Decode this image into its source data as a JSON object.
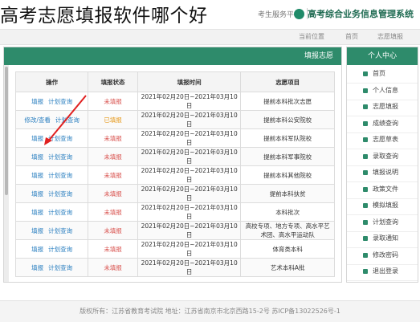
{
  "headline": "高考志愿填报软件哪个好",
  "topbar": {
    "brand": "高考综合业务信息管理系统",
    "sub": "考生服务平台"
  },
  "crumb": {
    "a": "当前位置",
    "b": "首页",
    "c": "志愿填报"
  },
  "main": {
    "header": "填报志愿",
    "columns": [
      "志愿项目",
      "填报时间",
      "填报状态",
      "操作"
    ],
    "rows": [
      {
        "item": "提前本科批次志愿",
        "time": "2021年02月20日~2021年03月10日",
        "status": "未填报",
        "actions": [
          "填报",
          "计划查询"
        ]
      },
      {
        "item": "提前本科公安院校",
        "time": "2021年02月20日~2021年03月10日",
        "status": "已填报",
        "actions": [
          "修改/查看",
          "计划查询"
        ]
      },
      {
        "item": "提前本科军队院校",
        "time": "2021年02月20日~2021年03月10日",
        "status": "未填报",
        "actions": [
          "填报",
          "计划查询"
        ]
      },
      {
        "item": "提前本科军事院校",
        "time": "2021年02月20日~2021年03月10日",
        "status": "未填报",
        "actions": [
          "填报",
          "计划查询"
        ]
      },
      {
        "item": "提前本科其他院校",
        "time": "2021年02月20日~2021年03月10日",
        "status": "未填报",
        "actions": [
          "填报",
          "计划查询"
        ]
      },
      {
        "item": "提前本科扶贫",
        "time": "2021年02月20日~2021年03月10日",
        "status": "未填报",
        "actions": [
          "填报",
          "计划查询"
        ]
      },
      {
        "item": "本科批次",
        "time": "2021年02月20日~2021年03月10日",
        "status": "未填报",
        "actions": [
          "填报",
          "计划查询"
        ]
      },
      {
        "item": "高校专项、地方专项、高水平艺术团、高水平运动队",
        "time": "2021年02月20日~2021年03月10日",
        "status": "未填报",
        "actions": [
          "填报",
          "计划查询"
        ]
      },
      {
        "item": "体育类本科",
        "time": "2021年02月20日~2021年03月10日",
        "status": "未填报",
        "actions": [
          "填报",
          "计划查询"
        ]
      },
      {
        "item": "艺术本科A批",
        "time": "2021年02月20日~2021年03月10日",
        "status": "未填报",
        "actions": [
          "填报",
          "计划查询"
        ]
      }
    ]
  },
  "sidebar": {
    "header": "个人中心",
    "items": [
      "首页",
      "个人信息",
      "志愿填报",
      "成绩查询",
      "志愿草表",
      "录取查询",
      "填报说明",
      "政策文件",
      "模拟填报",
      "计划查询",
      "录取通知",
      "修改密码",
      "退出登录"
    ]
  },
  "footer": "版权所有：江苏省教育考试院 地址：江苏省南京市北京西路15-2号 苏ICP备13022526号-1"
}
